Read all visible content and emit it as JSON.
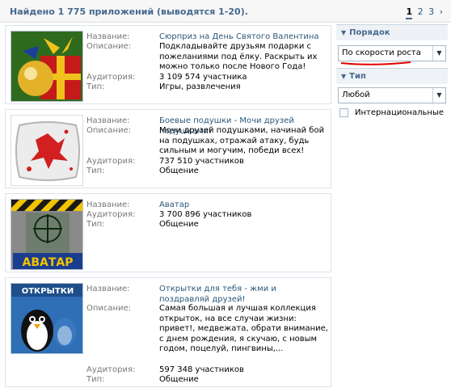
{
  "header": {
    "found_text": "Найдено 1 775 приложений (выводятся 1-20).",
    "pages": [
      "1",
      "2",
      "3"
    ],
    "next": "›"
  },
  "labels": {
    "name": "Название:",
    "desc": "Описание:",
    "aud": "Аудитория:",
    "type": "Тип:"
  },
  "apps": [
    {
      "name": "Сюрприз на День Святого Валентина",
      "description": "Подкладывайте друзьям подарки с пожеланиями под ёлку. Раскрыть их можно только после Нового Года!",
      "audience": "3 109 574 участника",
      "type": "Игры, развлечения"
    },
    {
      "name": "Боевые подушки - Мочи друзей подушками!",
      "description": "Мочи друзей подушками, начинай бой на подушках, отражай атаку, будь сильным и могучим, победи всех!",
      "audience": "737 510 участников",
      "type": "Общение"
    },
    {
      "name": "Аватар",
      "audience": "3 700 896 участников",
      "type": "Общение",
      "logo_text": "АВАТАР"
    },
    {
      "name": "Открытки для тебя - жми и поздравляй друзей!",
      "description": "Самая большая и лучшая коллекция открыток, на все случаи жизни: привет!, медвежата, обрати внимание, с днем рождения, я скучаю, с новым годом, поцелуй, пингвины,...",
      "audience": "597 348 участников",
      "type": "Общение",
      "logo_text": "ОТКРЫТКИ"
    }
  ],
  "sidebar": {
    "order_title": "Порядок",
    "order_value": "По скорости роста",
    "type_title": "Тип",
    "type_value": "Любой",
    "international_label": "Интернациональные"
  },
  "colors": {
    "accent": "#45688e",
    "link": "#2b587a",
    "border": "#dde3eb",
    "underline": "#e00000"
  }
}
